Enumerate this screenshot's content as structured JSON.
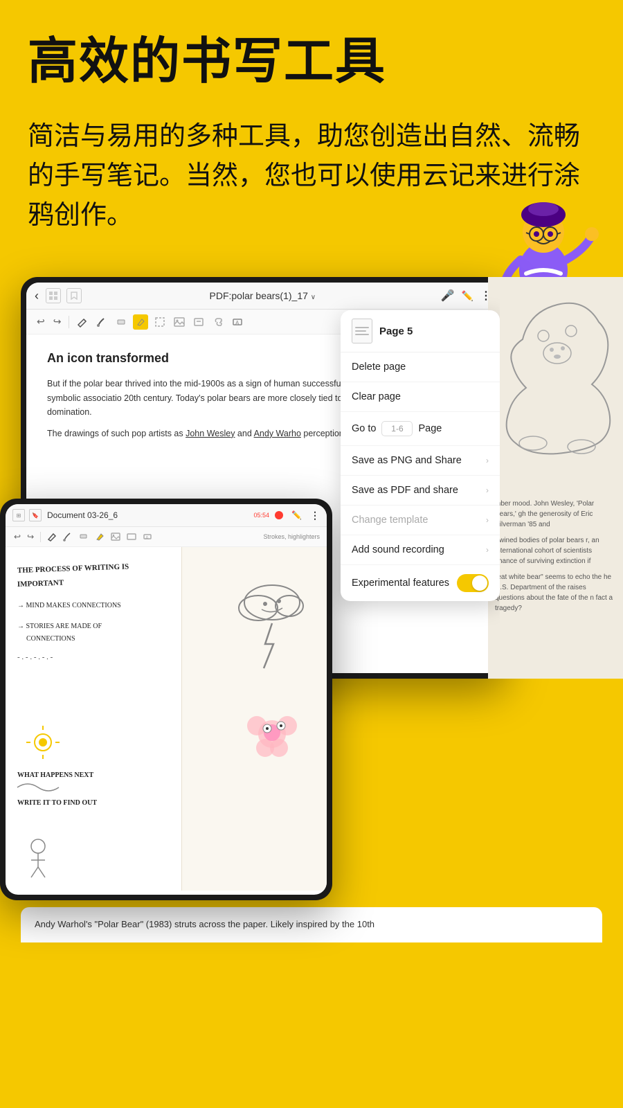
{
  "hero": {
    "title": "高效的书写工具",
    "description": "简洁与易用的多种工具，助您创造出自然、流畅的手写笔记。当然，您也可以使用云记来进行涂鸦创作。"
  },
  "tablet_main": {
    "back_btn": "‹",
    "title": "PDF:polar bears(1)_17",
    "title_arrow": "∨",
    "doc_title": "An icon transformed",
    "doc_para1": "But if the polar bear thrived into the mid-1900s as a sign of human successful mastery of antagonistic forces, this symbolic associatio 20th century. Today's polar bears are more closely tied to the dem belief in conquest and domination.",
    "doc_para2": "The drawings of such pop artists as John Wesley and Andy Warho perceptions.",
    "doc_bottom_text1": "mber mood. John Wesley, 'Polar Bears,' gh the generosity of Eric Silverman '85 and",
    "doc_bottom_text2": "rtwined bodies of polar bears r, an international cohort of scientists chance of surviving extinction if",
    "doc_bottom_text3": "reat white bear\" seems to echo the he U.S. Department of the raises questions about the fate of the n fact a tragedy?",
    "doc_bottom_caption": "Andy Warhol's \"Polar Bear\" (1983) struts across the paper. Likely inspired by the 10th"
  },
  "dropdown": {
    "page_label": "Page 5",
    "delete_page": "Delete page",
    "clear_page": "Clear page",
    "goto_label": "Go to",
    "goto_placeholder": "1-6",
    "page_word": "Page",
    "save_png": "Save as PNG and Share",
    "save_pdf": "Save as PDF and share",
    "change_template": "Change template",
    "add_sound": "Add sound recording",
    "experimental": "Experimental features"
  },
  "tablet_bottom": {
    "title": "Document 03-26_6",
    "timer": "05:54",
    "strokes_label": "Strokes, highlighters",
    "hw_lines": [
      "THE PROCESS OF WRITING IS",
      "IMPORTANT",
      "→ MIND MAKES CONNECTIONS",
      "→ STORIES ARE MADE OF",
      "   CONNECTIONS",
      "- - . - . - . - . -",
      "WHAT HAPPENS NEXT",
      "WRITE IT TO FIND OUT"
    ]
  },
  "bottom_strip": {
    "text": "Andy Warhol's \"Polar Bear\" (1983) struts across the paper. Likely inspired by the 10th"
  },
  "colors": {
    "yellow": "#F5C800",
    "dark": "#1a1a1a",
    "white": "#ffffff",
    "text": "#222222",
    "disabled": "#aaaaaa"
  }
}
